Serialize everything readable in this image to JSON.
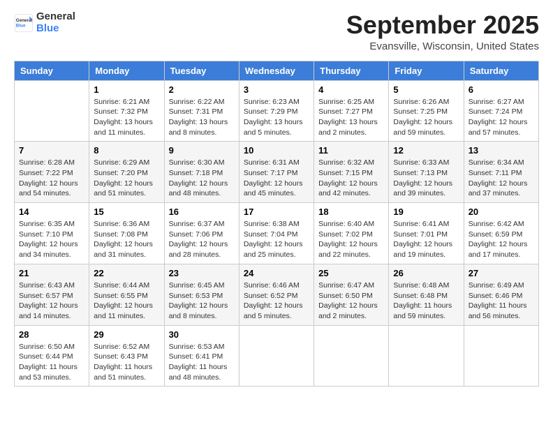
{
  "logo": {
    "text_general": "General",
    "text_blue": "Blue",
    "tagline": "GeneralBlue"
  },
  "header": {
    "month_title": "September 2025",
    "location": "Evansville, Wisconsin, United States"
  },
  "days_of_week": [
    "Sunday",
    "Monday",
    "Tuesday",
    "Wednesday",
    "Thursday",
    "Friday",
    "Saturday"
  ],
  "weeks": [
    [
      {
        "day": "",
        "info": ""
      },
      {
        "day": "1",
        "info": "Sunrise: 6:21 AM\nSunset: 7:32 PM\nDaylight: 13 hours\nand 11 minutes."
      },
      {
        "day": "2",
        "info": "Sunrise: 6:22 AM\nSunset: 7:31 PM\nDaylight: 13 hours\nand 8 minutes."
      },
      {
        "day": "3",
        "info": "Sunrise: 6:23 AM\nSunset: 7:29 PM\nDaylight: 13 hours\nand 5 minutes."
      },
      {
        "day": "4",
        "info": "Sunrise: 6:25 AM\nSunset: 7:27 PM\nDaylight: 13 hours\nand 2 minutes."
      },
      {
        "day": "5",
        "info": "Sunrise: 6:26 AM\nSunset: 7:25 PM\nDaylight: 12 hours\nand 59 minutes."
      },
      {
        "day": "6",
        "info": "Sunrise: 6:27 AM\nSunset: 7:24 PM\nDaylight: 12 hours\nand 57 minutes."
      }
    ],
    [
      {
        "day": "7",
        "info": "Sunrise: 6:28 AM\nSunset: 7:22 PM\nDaylight: 12 hours\nand 54 minutes."
      },
      {
        "day": "8",
        "info": "Sunrise: 6:29 AM\nSunset: 7:20 PM\nDaylight: 12 hours\nand 51 minutes."
      },
      {
        "day": "9",
        "info": "Sunrise: 6:30 AM\nSunset: 7:18 PM\nDaylight: 12 hours\nand 48 minutes."
      },
      {
        "day": "10",
        "info": "Sunrise: 6:31 AM\nSunset: 7:17 PM\nDaylight: 12 hours\nand 45 minutes."
      },
      {
        "day": "11",
        "info": "Sunrise: 6:32 AM\nSunset: 7:15 PM\nDaylight: 12 hours\nand 42 minutes."
      },
      {
        "day": "12",
        "info": "Sunrise: 6:33 AM\nSunset: 7:13 PM\nDaylight: 12 hours\nand 39 minutes."
      },
      {
        "day": "13",
        "info": "Sunrise: 6:34 AM\nSunset: 7:11 PM\nDaylight: 12 hours\nand 37 minutes."
      }
    ],
    [
      {
        "day": "14",
        "info": "Sunrise: 6:35 AM\nSunset: 7:10 PM\nDaylight: 12 hours\nand 34 minutes."
      },
      {
        "day": "15",
        "info": "Sunrise: 6:36 AM\nSunset: 7:08 PM\nDaylight: 12 hours\nand 31 minutes."
      },
      {
        "day": "16",
        "info": "Sunrise: 6:37 AM\nSunset: 7:06 PM\nDaylight: 12 hours\nand 28 minutes."
      },
      {
        "day": "17",
        "info": "Sunrise: 6:38 AM\nSunset: 7:04 PM\nDaylight: 12 hours\nand 25 minutes."
      },
      {
        "day": "18",
        "info": "Sunrise: 6:40 AM\nSunset: 7:02 PM\nDaylight: 12 hours\nand 22 minutes."
      },
      {
        "day": "19",
        "info": "Sunrise: 6:41 AM\nSunset: 7:01 PM\nDaylight: 12 hours\nand 19 minutes."
      },
      {
        "day": "20",
        "info": "Sunrise: 6:42 AM\nSunset: 6:59 PM\nDaylight: 12 hours\nand 17 minutes."
      }
    ],
    [
      {
        "day": "21",
        "info": "Sunrise: 6:43 AM\nSunset: 6:57 PM\nDaylight: 12 hours\nand 14 minutes."
      },
      {
        "day": "22",
        "info": "Sunrise: 6:44 AM\nSunset: 6:55 PM\nDaylight: 12 hours\nand 11 minutes."
      },
      {
        "day": "23",
        "info": "Sunrise: 6:45 AM\nSunset: 6:53 PM\nDaylight: 12 hours\nand 8 minutes."
      },
      {
        "day": "24",
        "info": "Sunrise: 6:46 AM\nSunset: 6:52 PM\nDaylight: 12 hours\nand 5 minutes."
      },
      {
        "day": "25",
        "info": "Sunrise: 6:47 AM\nSunset: 6:50 PM\nDaylight: 12 hours\nand 2 minutes."
      },
      {
        "day": "26",
        "info": "Sunrise: 6:48 AM\nSunset: 6:48 PM\nDaylight: 11 hours\nand 59 minutes."
      },
      {
        "day": "27",
        "info": "Sunrise: 6:49 AM\nSunset: 6:46 PM\nDaylight: 11 hours\nand 56 minutes."
      }
    ],
    [
      {
        "day": "28",
        "info": "Sunrise: 6:50 AM\nSunset: 6:44 PM\nDaylight: 11 hours\nand 53 minutes."
      },
      {
        "day": "29",
        "info": "Sunrise: 6:52 AM\nSunset: 6:43 PM\nDaylight: 11 hours\nand 51 minutes."
      },
      {
        "day": "30",
        "info": "Sunrise: 6:53 AM\nSunset: 6:41 PM\nDaylight: 11 hours\nand 48 minutes."
      },
      {
        "day": "",
        "info": ""
      },
      {
        "day": "",
        "info": ""
      },
      {
        "day": "",
        "info": ""
      },
      {
        "day": "",
        "info": ""
      }
    ]
  ]
}
